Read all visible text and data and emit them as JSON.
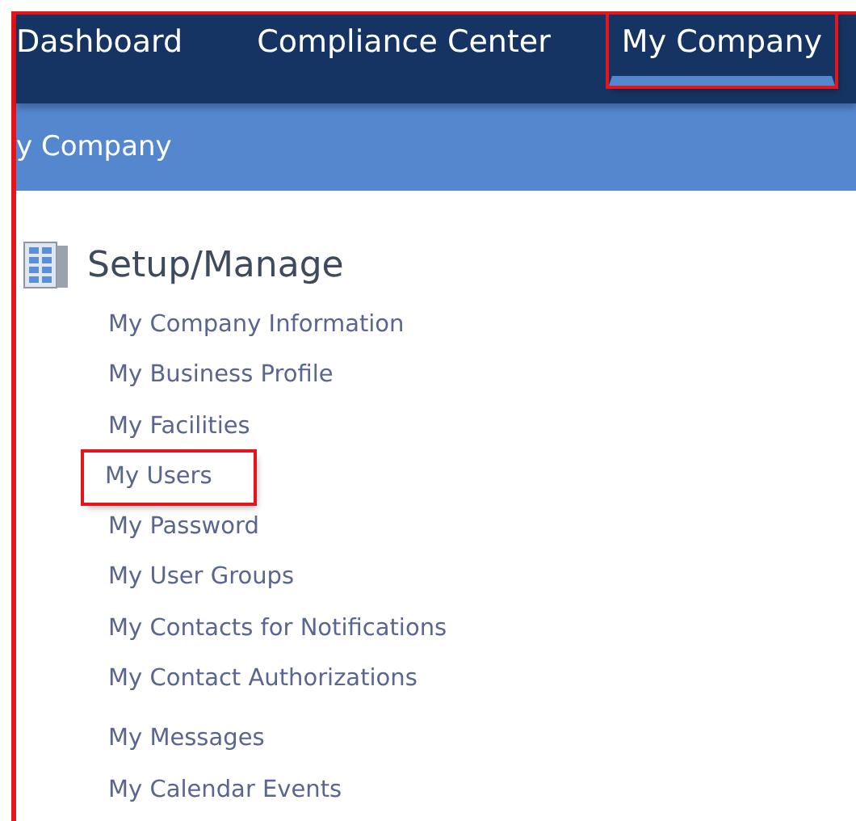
{
  "frame_highlighted": true,
  "nav_tabs": [
    {
      "label": "Dashboard",
      "selected": false,
      "highlighted": false
    },
    {
      "label": "Compliance Center",
      "selected": false,
      "highlighted": false
    },
    {
      "label": "My Company",
      "selected": true,
      "highlighted": true
    }
  ],
  "breadcrumb": "y Company",
  "section": {
    "title": "Setup/Manage",
    "links": [
      {
        "label": "My Company Information",
        "highlighted": false
      },
      {
        "label": "My Business Profile",
        "highlighted": false
      },
      {
        "label": "My Facilities",
        "highlighted": false
      },
      {
        "label": "My Users",
        "highlighted": true
      },
      {
        "label": "My Password",
        "highlighted": false
      },
      {
        "label": "My User Groups",
        "highlighted": false
      },
      {
        "label": "My Contacts for Notifications",
        "highlighted": false
      },
      {
        "label": "My Contact Authorizations",
        "highlighted": false
      },
      {
        "label": "My Messages",
        "highlighted": false
      },
      {
        "label": "My Calendar Events",
        "highlighted": false
      }
    ]
  }
}
